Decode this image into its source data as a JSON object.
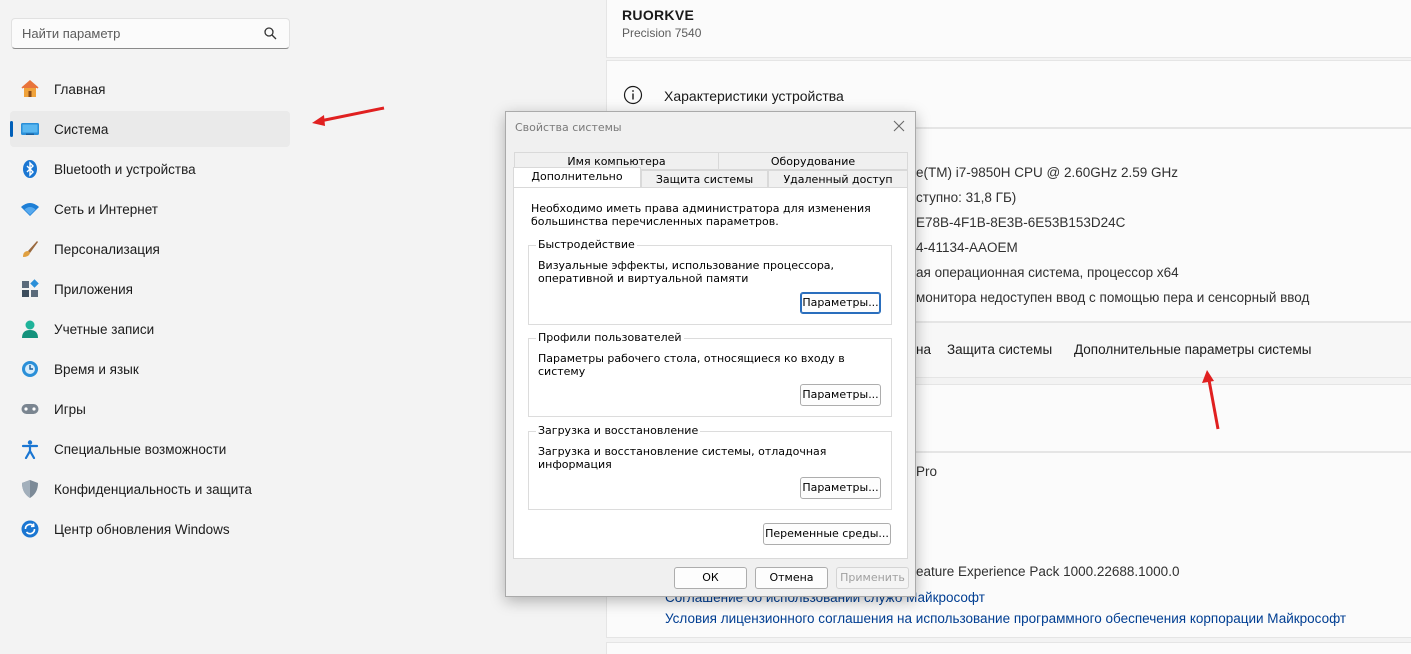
{
  "sidebar": {
    "search_placeholder": "Найти параметр",
    "items": [
      {
        "label": "Главная",
        "icon": "home-icon"
      },
      {
        "label": "Система",
        "icon": "system-icon"
      },
      {
        "label": "Bluetooth и устройства",
        "icon": "bluetooth-icon"
      },
      {
        "label": "Сеть и Интернет",
        "icon": "wifi-icon"
      },
      {
        "label": "Персонализация",
        "icon": "brush-icon"
      },
      {
        "label": "Приложения",
        "icon": "apps-icon"
      },
      {
        "label": "Учетные записи",
        "icon": "account-icon"
      },
      {
        "label": "Время и язык",
        "icon": "time-language-icon"
      },
      {
        "label": "Игры",
        "icon": "gamepad-icon"
      },
      {
        "label": "Специальные возможности",
        "icon": "accessibility-icon"
      },
      {
        "label": "Конфиденциальность и защита",
        "icon": "shield-icon"
      },
      {
        "label": "Центр обновления Windows",
        "icon": "update-icon"
      }
    ]
  },
  "device": {
    "name": "RUORKVE",
    "model": "Precision 7540"
  },
  "specs": {
    "title": "Характеристики устройства",
    "lines": [
      "e(TM) i7-9850H CPU @ 2.60GHz   2.59 GHz",
      "ступно: 31,8 ГБ)",
      "E78B-4F1B-8E3B-6E53B153D24C",
      "4-41134-AAOEM",
      "ая операционная система, процессор x64",
      "монитора недоступен ввод с помощью пера и сенсорный ввод"
    ],
    "related_partial": "на",
    "related_protection": "Защита системы",
    "related_advanced": "Дополнительные параметры системы"
  },
  "windows": {
    "edition_partial": "Pro",
    "experience_partial": "eature Experience Pack 1000.22688.1000.0",
    "link_services": "Соглашение об использовании служб Майкрософт",
    "link_license": "Условия лицензионного соглашения на использование программного обеспечения корпорации Майкрософт"
  },
  "dialog": {
    "title": "Свойства системы",
    "tabs_row1": [
      "Имя компьютера",
      "Оборудование"
    ],
    "tabs_row2": [
      "Дополнительно",
      "Защита системы",
      "Удаленный доступ"
    ],
    "active_tab": "Дополнительно",
    "note": "Необходимо иметь права администратора для изменения большинства перечисленных параметров.",
    "groups": [
      {
        "title": "Быстродействие",
        "desc": "Визуальные эффекты, использование процессора, оперативной и виртуальной памяти",
        "button": "Параметры..."
      },
      {
        "title": "Профили пользователей",
        "desc": "Параметры рабочего стола, относящиеся ко входу в систему",
        "button": "Параметры..."
      },
      {
        "title": "Загрузка и восстановление",
        "desc": "Загрузка и восстановление системы, отладочная информация",
        "button": "Параметры..."
      }
    ],
    "env_button": "Переменные среды...",
    "ok": "ОК",
    "cancel": "Отмена",
    "apply": "Применить"
  },
  "colors": {
    "accent": "#005fb8",
    "link": "#003e92",
    "arrow": "#e02020"
  }
}
